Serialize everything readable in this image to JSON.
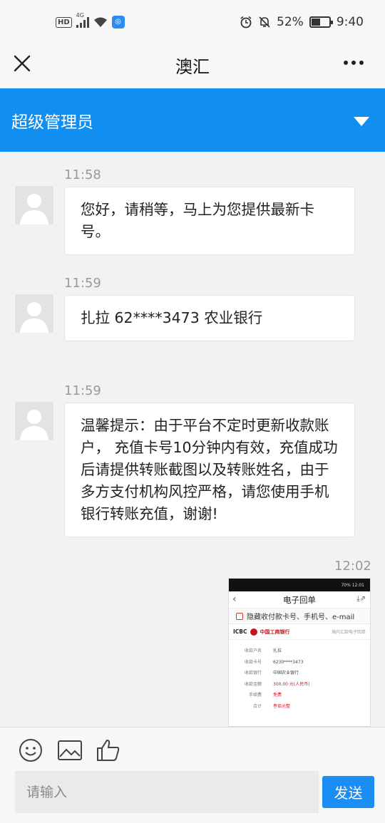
{
  "status_bar": {
    "hd": "HD",
    "network": "4G",
    "battery_percent": "52%",
    "battery_level": 0.52,
    "time": "9:40"
  },
  "titlebar": {
    "title": "澳汇"
  },
  "admin": {
    "name": "超级管理员"
  },
  "messages": [
    {
      "time": "11:58",
      "text": "您好，请稍等，马上为您提供最新卡号。"
    },
    {
      "time": "11:59",
      "text": "扎拉 62****3473 农业银行"
    },
    {
      "time": "11:59",
      "text": "温馨提示：由于平台不定时更新收款账户， 充值卡号10分钟内有效，充值成功后请提供转账截图以及转账姓名，由于多方支付机构风控严格，请您使用手机银行转账充值，谢谢!"
    }
  ],
  "image_message": {
    "time": "12:02",
    "receipt": {
      "status_right": "70% 12:01",
      "title": "电子回单",
      "checkbox_label": "隐藏收付款卡号、手机号、e-mail",
      "icbc": "ICBC",
      "bank_name": "中国工商银行",
      "receipt_type": "境内汇款电子回单",
      "rows": [
        {
          "k": "收款户名",
          "v": "扎拉"
        },
        {
          "k": "收款卡号",
          "v": "6230****3473"
        },
        {
          "k": "收款银行",
          "v": "中国农业银行"
        },
        {
          "k": "收款金额",
          "v": "300.00 元(人民币)"
        },
        {
          "k": "手续费",
          "v": "免费"
        },
        {
          "k": "合计",
          "v": "叁佰元整"
        }
      ]
    }
  },
  "input": {
    "placeholder": "请输入",
    "send_label": "发送"
  },
  "colors": {
    "accent": "#108ff0",
    "send": "#1a8ef2"
  }
}
